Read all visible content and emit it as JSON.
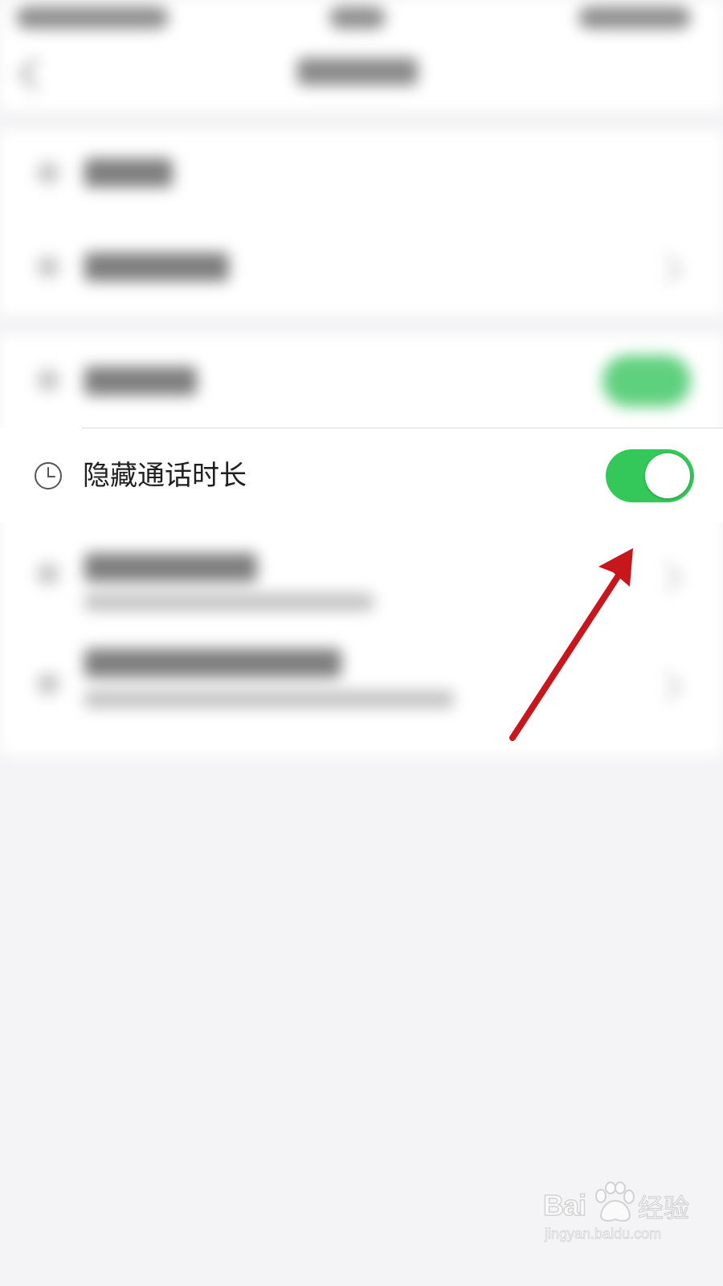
{
  "settings_row": {
    "label": "隐藏通话时长",
    "icon": "clock-icon",
    "toggle_state": "on",
    "toggle_color": "#34c759"
  },
  "annotation": {
    "arrow_color": "#c8161d"
  },
  "watermark": {
    "brand": "Bai",
    "brand_suffix": "经验",
    "url": "jingyan.baidu.com"
  }
}
